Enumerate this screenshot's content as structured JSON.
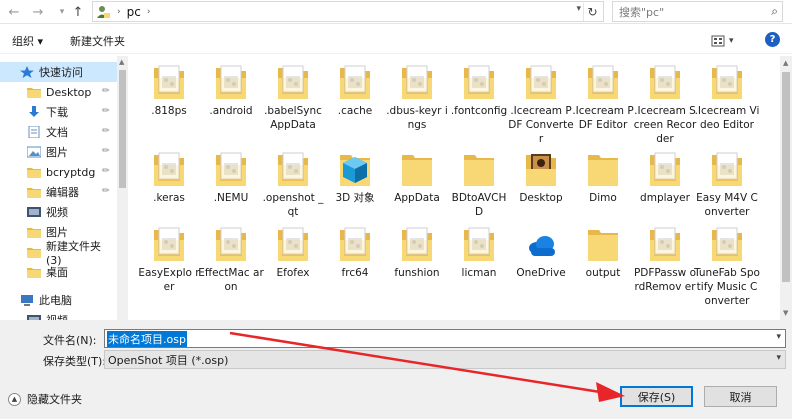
{
  "address": {
    "location": "pc",
    "search_placeholder": "搜索\"pc\""
  },
  "toolbar": {
    "organize_label": "组织 ▾",
    "new_folder_label": "新建文件夹"
  },
  "nav": {
    "items": [
      {
        "label": "快速访问",
        "icon": "star-icon",
        "pinned": false
      },
      {
        "label": "Desktop",
        "icon": "folder-icon",
        "pinned": true
      },
      {
        "label": "下载",
        "icon": "download-icon",
        "pinned": true
      },
      {
        "label": "文档",
        "icon": "documents-icon",
        "pinned": true
      },
      {
        "label": "图片",
        "icon": "pictures-icon",
        "pinned": true
      },
      {
        "label": "bcryptdg",
        "icon": "folder-icon",
        "pinned": true
      },
      {
        "label": "编辑器",
        "icon": "folder-icon",
        "pinned": true
      },
      {
        "label": "视频",
        "icon": "video-icon",
        "pinned": false
      },
      {
        "label": "图片",
        "icon": "folder-icon",
        "pinned": false
      },
      {
        "label": "新建文件夹 (3)",
        "icon": "folder-icon",
        "pinned": false
      },
      {
        "label": "桌面",
        "icon": "desktop-icon",
        "pinned": false
      },
      {
        "label": "此电脑",
        "icon": "computer-icon",
        "pinned": false
      },
      {
        "label": "视频",
        "icon": "video-icon",
        "pinned": false
      }
    ]
  },
  "files": [
    {
      "name": ".818ps",
      "kind": "doc-folder"
    },
    {
      "name": ".android",
      "kind": "doc-folder"
    },
    {
      "name": ".babelSync AppData",
      "kind": "doc-folder"
    },
    {
      "name": ".cache",
      "kind": "doc-folder"
    },
    {
      "name": ".dbus-keyr ings",
      "kind": "doc-folder"
    },
    {
      "name": ".fontconfig",
      "kind": "doc-folder"
    },
    {
      "name": ".Icecream PDF Converter",
      "kind": "doc-folder"
    },
    {
      "name": ".Icecream PDF Editor",
      "kind": "doc-folder"
    },
    {
      "name": ".Icecream Screen Recorder",
      "kind": "doc-folder"
    },
    {
      "name": ".Icecream Video Editor",
      "kind": "doc-folder"
    },
    {
      "name": ".keras",
      "kind": "doc-folder"
    },
    {
      "name": ".NEMU",
      "kind": "doc-folder"
    },
    {
      "name": ".openshot _qt",
      "kind": "doc-folder"
    },
    {
      "name": "3D 对象",
      "kind": "3d-folder"
    },
    {
      "name": "AppData",
      "kind": "plain-folder"
    },
    {
      "name": "BDtoAVCH D",
      "kind": "plain-folder"
    },
    {
      "name": "Desktop",
      "kind": "photo-folder"
    },
    {
      "name": "Dimo",
      "kind": "plain-folder"
    },
    {
      "name": "dmplayer",
      "kind": "doc-folder"
    },
    {
      "name": "Easy M4V Converter",
      "kind": "doc-folder"
    },
    {
      "name": "EasyExplo rer",
      "kind": "doc-folder"
    },
    {
      "name": "EffectMac aron",
      "kind": "doc-folder"
    },
    {
      "name": "Efofex",
      "kind": "doc-folder"
    },
    {
      "name": "frc64",
      "kind": "doc-folder"
    },
    {
      "name": "funshion",
      "kind": "doc-folder"
    },
    {
      "name": "licman",
      "kind": "doc-folder"
    },
    {
      "name": "OneDrive",
      "kind": "cloud-folder"
    },
    {
      "name": "output",
      "kind": "plain-folder"
    },
    {
      "name": "PDFPassw ordRemov er",
      "kind": "doc-folder"
    },
    {
      "name": "TuneFab Spotify Music Converter",
      "kind": "doc-folder"
    }
  ],
  "form": {
    "filename_label": "文件名(N):",
    "filename_value": "未命名项目.osp",
    "filetype_label": "保存类型(T):",
    "filetype_value": "OpenShot 项目 (*.osp)",
    "hide_folders_label": "隐藏文件夹",
    "save_label": "保存(S)",
    "cancel_label": "取消"
  },
  "colors": {
    "folder": "#f8d775",
    "folder_dark": "#e8b84a",
    "selection": "#0078d7",
    "annotation_arrow": "#e8262a"
  }
}
